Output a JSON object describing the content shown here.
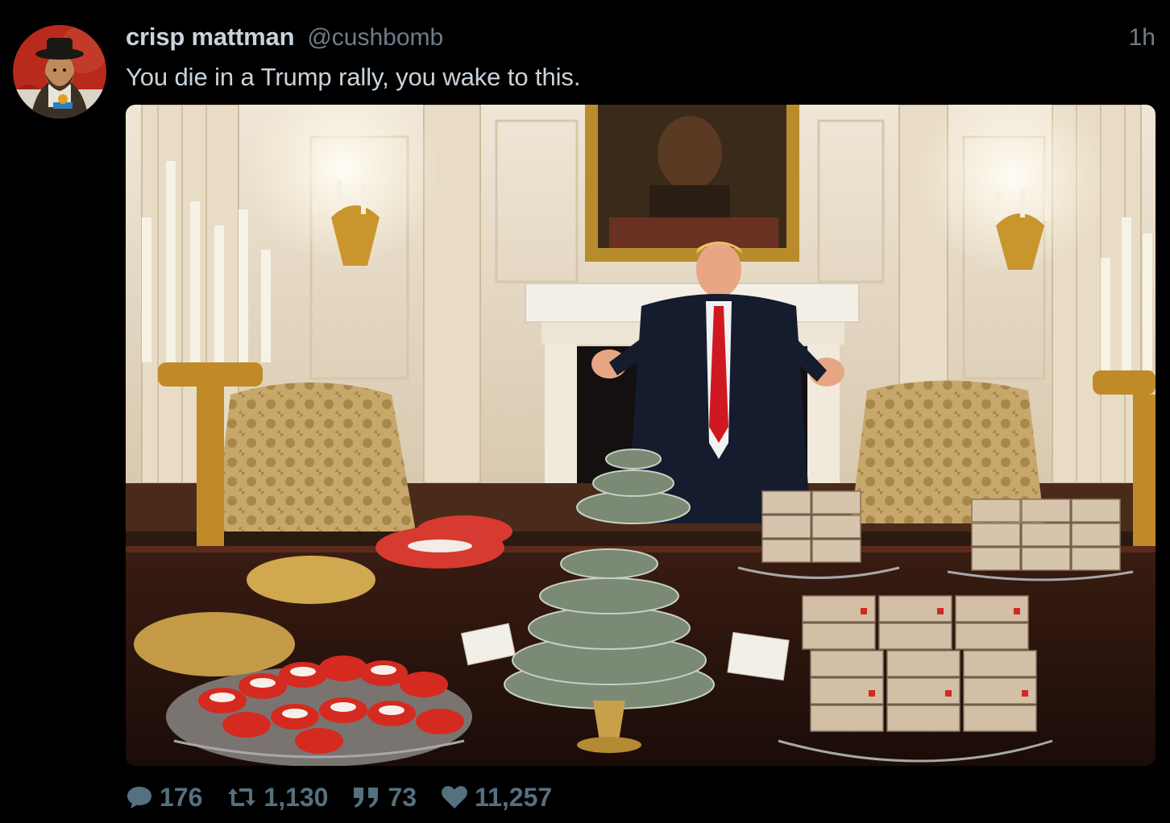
{
  "tweet": {
    "display_name": "crisp mattman",
    "handle": "@cushbomb",
    "timestamp": "1h",
    "text": "You die in a Trump rally, you wake to this.",
    "avatar_icon": "avatar-portrait-icon",
    "media_description": "photo-attachment",
    "actions": {
      "replies": "176",
      "retweets": "1,130",
      "quotes": "73",
      "likes": "11,257"
    }
  },
  "colors": {
    "background": "#000000",
    "text_primary": "#c9d3dc",
    "text_secondary": "#6e7d8a",
    "action_color": "#55707f"
  }
}
